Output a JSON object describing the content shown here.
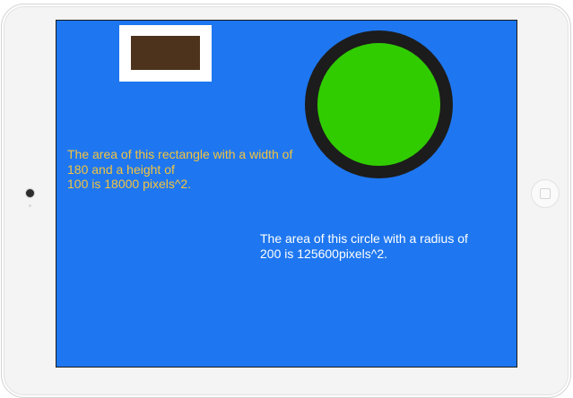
{
  "screen": {
    "background_color": "#1e77f0",
    "rectangle": {
      "frame_color": "#ffffff",
      "fill_color": "#4e331c"
    },
    "circle": {
      "fill_color": "#31cc00",
      "stroke_color": "#1c1c1c"
    },
    "rectangle_text": {
      "text": "The area of this rectangle with a width of\n180 and a height of\n100 is 18000 pixels^2.",
      "color": "#f3c33f"
    },
    "circle_text": {
      "text": "The area of this circle with a radius of\n200 is 125600pixels^2.",
      "color": "#ffffff"
    }
  },
  "device": {
    "frame_color": "#f4f4f4",
    "camera_icon": "camera-lens",
    "home_button_icon": "home-square"
  }
}
